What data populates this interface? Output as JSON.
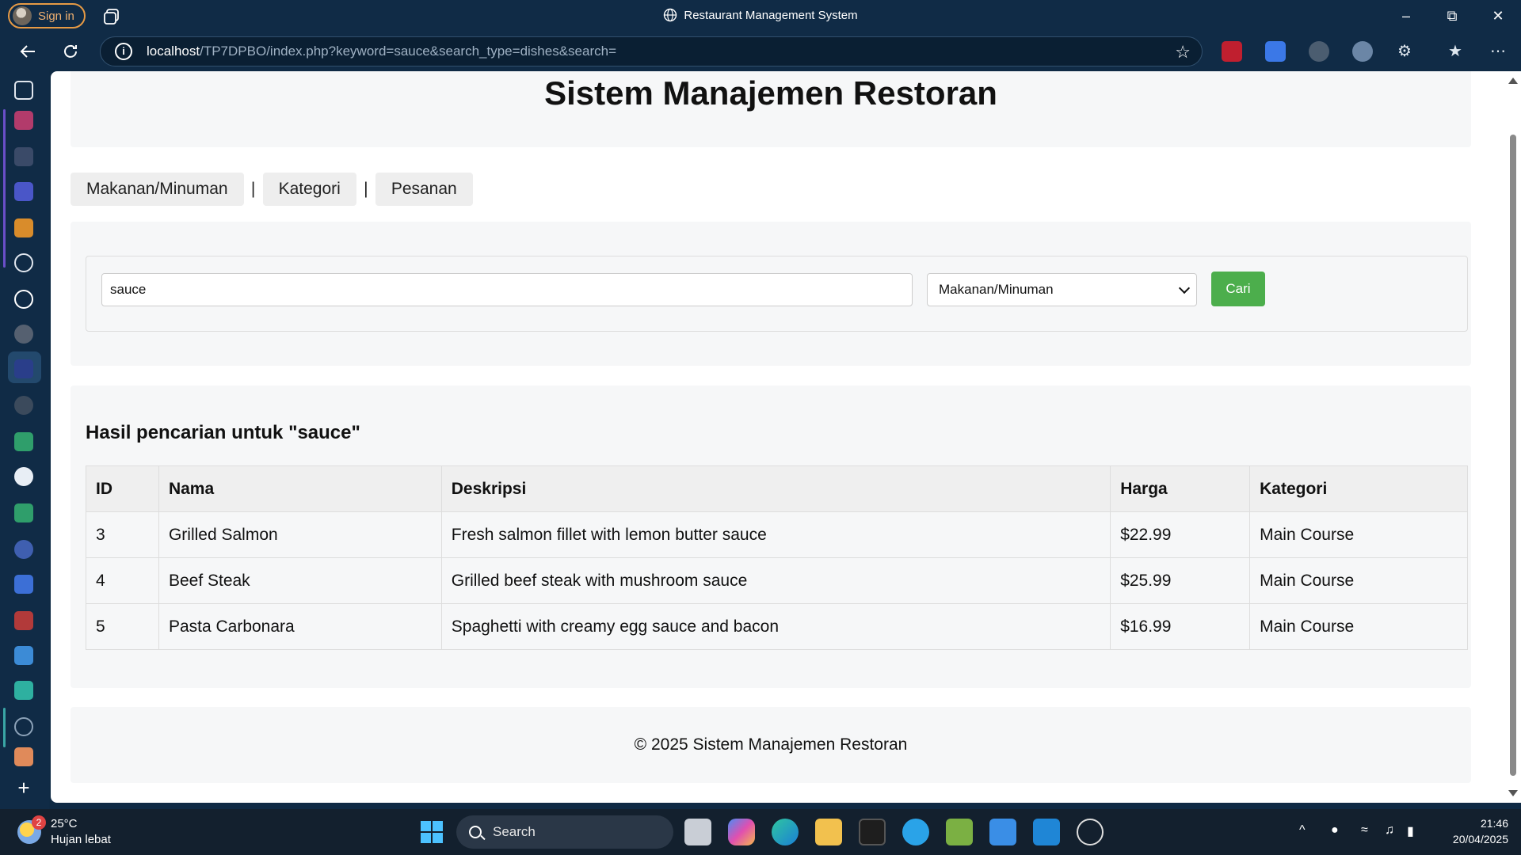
{
  "browser": {
    "signin_label": "Sign in",
    "window_title": "Restaurant Management System",
    "url_host": "localhost",
    "url_path": "/TP7DPBO/index.php?keyword=sauce&search_type=dishes&search="
  },
  "page": {
    "title": "Sistem Manajemen Restoran",
    "nav": [
      {
        "label": "Makanan/Minuman"
      },
      {
        "label": "Kategori"
      },
      {
        "label": "Pesanan"
      }
    ],
    "nav_separator": "|",
    "search": {
      "keyword_value": "sauce",
      "type_selected": "Makanan/Minuman",
      "button_label": "Cari"
    },
    "results": {
      "heading": "Hasil pencarian untuk \"sauce\"",
      "columns": [
        "ID",
        "Nama",
        "Deskripsi",
        "Harga",
        "Kategori"
      ],
      "rows": [
        [
          "3",
          "Grilled Salmon",
          "Fresh salmon fillet with lemon butter sauce",
          "$22.99",
          "Main Course"
        ],
        [
          "4",
          "Beef Steak",
          "Grilled beef steak with mushroom sauce",
          "$25.99",
          "Main Course"
        ],
        [
          "5",
          "Pasta Carbonara",
          "Spaghetti with creamy egg sauce and bacon",
          "$16.99",
          "Main Course"
        ]
      ]
    },
    "footer": "© 2025 Sistem Manajemen Restoran"
  },
  "taskbar": {
    "weather_temp": "25°C",
    "weather_condition": "Hujan lebat",
    "weather_badge": "2",
    "search_label": "Search",
    "time": "21:46",
    "date": "20/04/2025"
  },
  "colors": {
    "button_green": "#4cae4c",
    "browser_chrome": "#102b46",
    "taskbar": "#13202e"
  }
}
